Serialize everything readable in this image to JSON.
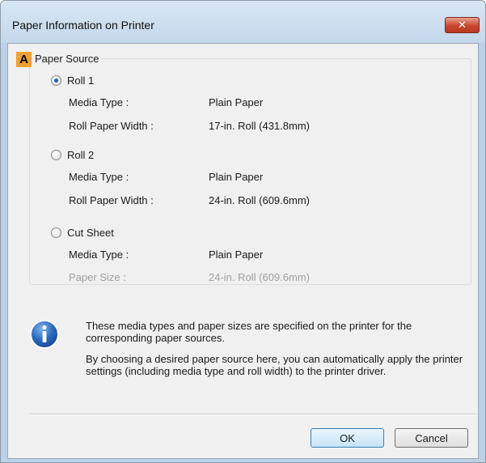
{
  "window": {
    "title": "Paper Information on Printer",
    "close_glyph": "✕"
  },
  "group": {
    "marker": "A",
    "legend": "Paper Source",
    "sources": [
      {
        "label": "Roll 1",
        "selected": true,
        "rows": [
          {
            "label": "Media Type :",
            "value": "Plain Paper",
            "disabled": false
          },
          {
            "label": "Roll Paper Width :",
            "value": "17-in. Roll (431.8mm)",
            "disabled": false
          }
        ]
      },
      {
        "label": "Roll 2",
        "selected": false,
        "rows": [
          {
            "label": "Media Type :",
            "value": "Plain Paper",
            "disabled": false
          },
          {
            "label": "Roll Paper Width :",
            "value": "24-in. Roll (609.6mm)",
            "disabled": false
          }
        ]
      },
      {
        "label": "Cut Sheet",
        "selected": false,
        "rows": [
          {
            "label": "Media Type :",
            "value": "Plain Paper",
            "disabled": false
          },
          {
            "label": "Paper Size :",
            "value": "24-in. Roll (609.6mm)",
            "disabled": true
          }
        ]
      }
    ]
  },
  "info": {
    "icon": "info-icon",
    "text1": "These media types and paper sizes are specified on the printer for the corresponding paper sources.",
    "text2": "By choosing a desired paper source here, you can automatically apply the printer settings (including media type and roll width) to the printer driver."
  },
  "buttons": {
    "ok": "OK",
    "cancel": "Cancel"
  },
  "colors": {
    "marker": "#f0a030",
    "close": "#c8462c"
  }
}
